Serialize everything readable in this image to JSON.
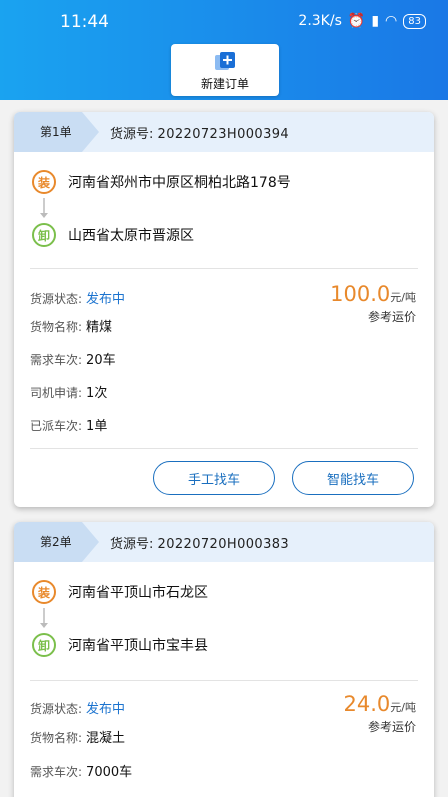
{
  "status_bar": {
    "time": "11:44",
    "speed": "2.3K/s",
    "battery": "83"
  },
  "toolbar": {
    "new_order_label": "新建订单"
  },
  "orders": [
    {
      "badge": "第1单",
      "source_label": "货源号:",
      "source_no": "20220723H000394",
      "load_tag": "装",
      "unload_tag": "卸",
      "load_address": "河南省郑州市中原区桐柏北路178号",
      "unload_address": "山西省太原市晋源区",
      "status_label": "货源状态:",
      "status_value": "发布中",
      "goods_label": "货物名称:",
      "goods_value": "精煤",
      "trips_label": "需求车次:",
      "trips_value": "20车",
      "apply_label": "司机申请:",
      "apply_value": "1次",
      "dispatched_label": "已派车次:",
      "dispatched_value": "1单",
      "price": "100.0",
      "price_unit": "元/吨",
      "price_ref": "参考运价",
      "manual_btn": "手工找车",
      "smart_btn": "智能找车"
    },
    {
      "badge": "第2单",
      "source_label": "货源号:",
      "source_no": "20220720H000383",
      "load_tag": "装",
      "unload_tag": "卸",
      "load_address": "河南省平顶山市石龙区",
      "unload_address": "河南省平顶山市宝丰县",
      "status_label": "货源状态:",
      "status_value": "发布中",
      "goods_label": "货物名称:",
      "goods_value": "混凝土",
      "trips_label": "需求车次:",
      "trips_value": "7000车",
      "price": "24.0",
      "price_unit": "元/吨",
      "price_ref": "参考运价"
    }
  ],
  "colors": {
    "accent": "#1a78e6",
    "price": "#e8892c",
    "status": "#1b73cf"
  }
}
